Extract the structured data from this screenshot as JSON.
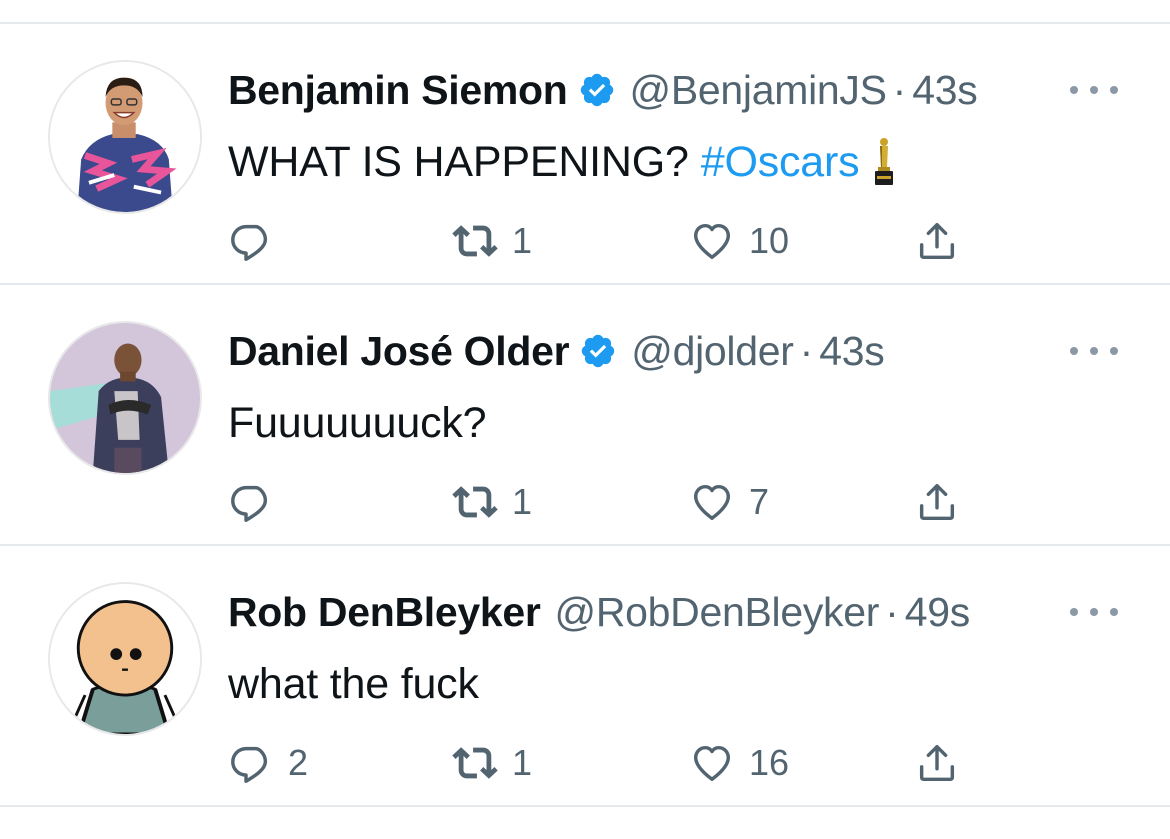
{
  "tweets": [
    {
      "name": "Benjamin Siemon",
      "verified": true,
      "handle": "@BenjaminJS",
      "separator": "·",
      "time": "43s",
      "text": "WHAT IS HAPPENING?",
      "hashtag": "#Oscars",
      "emoji": "oscar-trophy",
      "counts": {
        "reply": "",
        "retweet": "1",
        "like": "10"
      }
    },
    {
      "name": "Daniel José Older",
      "verified": true,
      "handle": "@djolder",
      "separator": "·",
      "time": "43s",
      "text": "Fuuuuuuuck?",
      "counts": {
        "reply": "",
        "retweet": "1",
        "like": "7"
      }
    },
    {
      "name": "Rob DenBleyker",
      "verified": false,
      "handle": "@RobDenBleyker",
      "separator": "·",
      "time": "49s",
      "text": "what the fuck",
      "counts": {
        "reply": "2",
        "retweet": "1",
        "like": "16"
      }
    }
  ],
  "colors": {
    "verified_badge": "#1d9bf0",
    "hashtag": "#1d9bf0",
    "secondary_text": "#536471",
    "divider": "#e6e9eb"
  },
  "icons": {
    "reply": "reply-icon",
    "retweet": "retweet-icon",
    "like": "heart-icon",
    "share": "share-icon",
    "more": "more-dots-icon",
    "verified": "verified-badge-icon"
  }
}
